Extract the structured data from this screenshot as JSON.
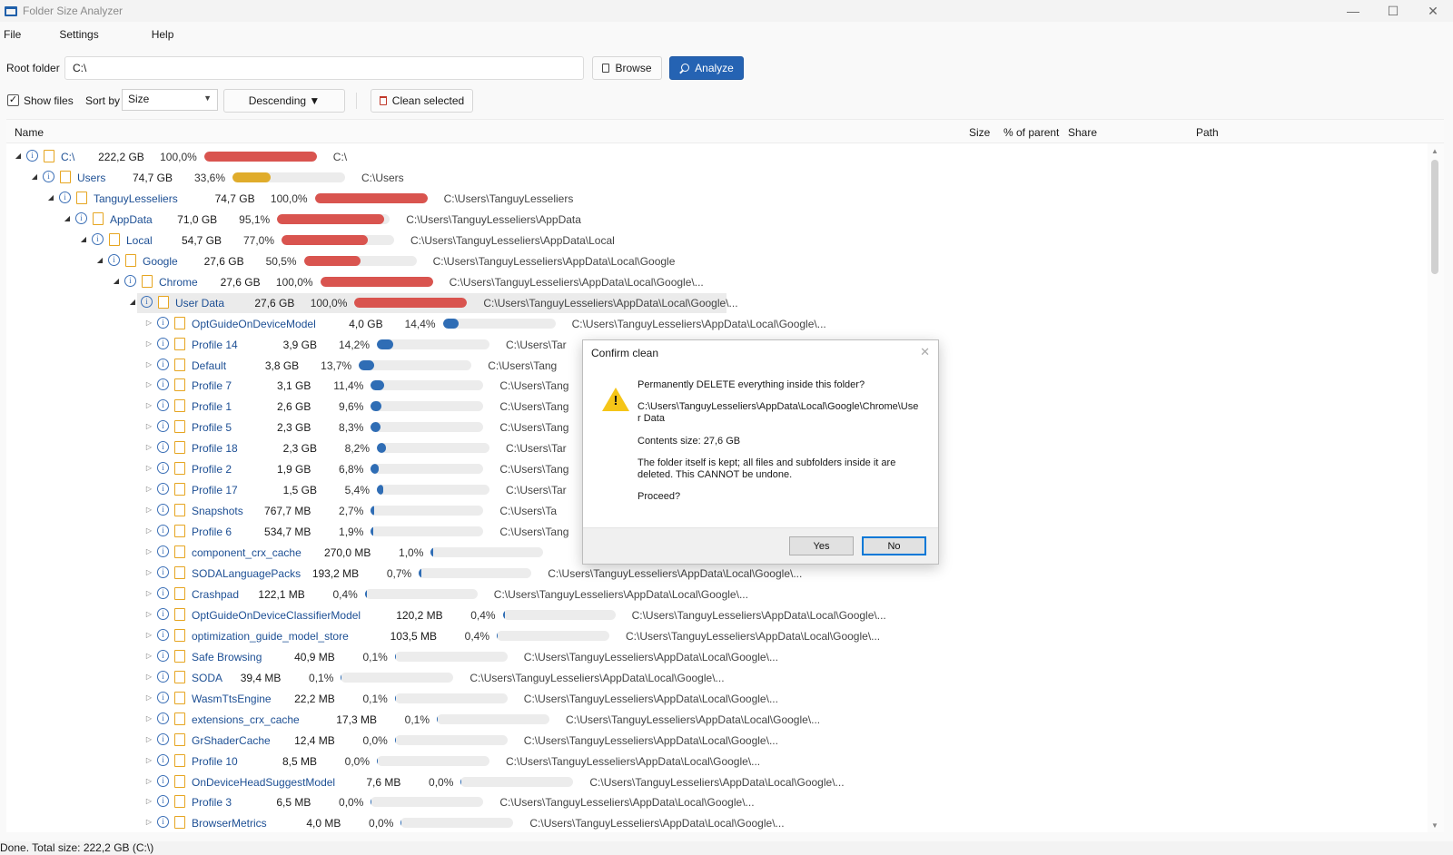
{
  "window": {
    "title": "Folder Size Analyzer",
    "controls": [
      "—",
      "☐",
      "✕"
    ]
  },
  "menu": [
    "File",
    "Settings",
    "Help"
  ],
  "root": {
    "label": "Root folder",
    "value": "C:\\",
    "browse_label": "Browse",
    "analyze_label": "Analyze"
  },
  "options": {
    "show_files_label": "Show files",
    "show_files_checked": true,
    "sort_by_label": "Sort by",
    "sort_value": "Size",
    "order_label": "Descending ▼",
    "clean_label": "Clean selected"
  },
  "columns": {
    "name": "Name",
    "size": "Size",
    "pct": "% of parent",
    "share": "Share",
    "path": "Path"
  },
  "colors": {
    "red": "#d9544f",
    "amber": "#e0ac2b",
    "blue": "#2f6db5",
    "accent": "#2563b3"
  },
  "tree": [
    {
      "depth": 0,
      "expanded": true,
      "name": "C:\\",
      "size": "222,2 GB",
      "pct": "100,0%",
      "share": 1.0,
      "color": "red",
      "path": "C:\\"
    },
    {
      "depth": 1,
      "expanded": true,
      "name": "Users",
      "size": "74,7 GB",
      "pct": "33,6%",
      "share": 0.336,
      "color": "amber",
      "path": "C:\\Users"
    },
    {
      "depth": 2,
      "expanded": true,
      "name": "TanguyLesseliers",
      "size": "74,7 GB",
      "pct": "100,0%",
      "share": 1.0,
      "color": "red",
      "path": "C:\\Users\\TanguyLesseliers"
    },
    {
      "depth": 3,
      "expanded": true,
      "name": "AppData",
      "size": "71,0 GB",
      "pct": "95,1%",
      "share": 0.951,
      "color": "red",
      "path": "C:\\Users\\TanguyLesseliers\\AppData"
    },
    {
      "depth": 4,
      "expanded": true,
      "name": "Local",
      "size": "54,7 GB",
      "pct": "77,0%",
      "share": 0.77,
      "color": "red",
      "path": "C:\\Users\\TanguyLesseliers\\AppData\\Local"
    },
    {
      "depth": 5,
      "expanded": true,
      "name": "Google",
      "size": "27,6 GB",
      "pct": "50,5%",
      "share": 0.505,
      "color": "red",
      "path": "C:\\Users\\TanguyLesseliers\\AppData\\Local\\Google"
    },
    {
      "depth": 6,
      "expanded": true,
      "name": "Chrome",
      "size": "27,6 GB",
      "pct": "100,0%",
      "share": 1.0,
      "color": "red",
      "path": "C:\\Users\\TanguyLesseliers\\AppData\\Local\\Google\\..."
    },
    {
      "depth": 7,
      "expanded": true,
      "selected": true,
      "name": "User Data",
      "size": "27,6 GB",
      "pct": "100,0%",
      "share": 1.0,
      "color": "red",
      "path": "C:\\Users\\TanguyLesseliers\\AppData\\Local\\Google\\..."
    },
    {
      "depth": 8,
      "name": "OptGuideOnDeviceModel",
      "size": "4,0 GB",
      "pct": "14,4%",
      "share": 0.144,
      "color": "blue",
      "path": "C:\\Users\\TanguyLesseliers\\AppData\\Local\\Google\\..."
    },
    {
      "depth": 8,
      "name": "Profile 14",
      "size": "3,9 GB",
      "pct": "14,2%",
      "share": 0.142,
      "color": "blue",
      "path": "C:\\Users\\Tar"
    },
    {
      "depth": 8,
      "name": "Default",
      "size": "3,8 GB",
      "pct": "13,7%",
      "share": 0.137,
      "color": "blue",
      "path": "C:\\Users\\Tang"
    },
    {
      "depth": 8,
      "name": "Profile 7",
      "size": "3,1 GB",
      "pct": "11,4%",
      "share": 0.114,
      "color": "blue",
      "path": "C:\\Users\\Tang"
    },
    {
      "depth": 8,
      "name": "Profile 1",
      "size": "2,6 GB",
      "pct": "9,6%",
      "share": 0.096,
      "color": "blue",
      "path": "C:\\Users\\Tang"
    },
    {
      "depth": 8,
      "name": "Profile 5",
      "size": "2,3 GB",
      "pct": "8,3%",
      "share": 0.083,
      "color": "blue",
      "path": "C:\\Users\\Tang"
    },
    {
      "depth": 8,
      "name": "Profile 18",
      "size": "2,3 GB",
      "pct": "8,2%",
      "share": 0.082,
      "color": "blue",
      "path": "C:\\Users\\Tar"
    },
    {
      "depth": 8,
      "name": "Profile 2",
      "size": "1,9 GB",
      "pct": "6,8%",
      "share": 0.068,
      "color": "blue",
      "path": "C:\\Users\\Tang"
    },
    {
      "depth": 8,
      "name": "Profile 17",
      "size": "1,5 GB",
      "pct": "5,4%",
      "share": 0.054,
      "color": "blue",
      "path": "C:\\Users\\Tar"
    },
    {
      "depth": 8,
      "name": "Snapshots",
      "size": "767,7 MB",
      "pct": "2,7%",
      "share": 0.027,
      "color": "blue",
      "path": "C:\\Users\\Ta"
    },
    {
      "depth": 8,
      "name": "Profile 6",
      "size": "534,7 MB",
      "pct": "1,9%",
      "share": 0.019,
      "color": "blue",
      "path": "C:\\Users\\Tang"
    },
    {
      "depth": 8,
      "name": "component_crx_cache",
      "size": "270,0 MB",
      "pct": "1,0%",
      "share": 0.01,
      "color": "blue",
      "path": ""
    },
    {
      "depth": 8,
      "name": "SODALanguagePacks",
      "size": "193,2 MB",
      "pct": "0,7%",
      "share": 0.007,
      "color": "blue",
      "path": "C:\\Users\\TanguyLesseliers\\AppData\\Local\\Google\\..."
    },
    {
      "depth": 8,
      "name": "Crashpad",
      "size": "122,1 MB",
      "pct": "0,4%",
      "share": 0.004,
      "color": "blue",
      "path": "C:\\Users\\TanguyLesseliers\\AppData\\Local\\Google\\..."
    },
    {
      "depth": 8,
      "name": "OptGuideOnDeviceClassifierModel",
      "size": "120,2 MB",
      "pct": "0,4%",
      "share": 0.004,
      "color": "blue",
      "path": "C:\\Users\\TanguyLesseliers\\AppData\\Local\\Google\\..."
    },
    {
      "depth": 8,
      "name": "optimization_guide_model_store",
      "size": "103,5 MB",
      "pct": "0,4%",
      "share": 0.0,
      "color": "blue",
      "path": "C:\\Users\\TanguyLesseliers\\AppData\\Local\\Google\\..."
    },
    {
      "depth": 8,
      "name": "Safe Browsing",
      "size": "40,9 MB",
      "pct": "0,1%",
      "share": 0.0,
      "color": "blue",
      "path": "C:\\Users\\TanguyLesseliers\\AppData\\Local\\Google\\..."
    },
    {
      "depth": 8,
      "name": "SODA",
      "size": "39,4 MB",
      "pct": "0,1%",
      "share": 0.0,
      "color": "blue",
      "path": "C:\\Users\\TanguyLesseliers\\AppData\\Local\\Google\\..."
    },
    {
      "depth": 8,
      "name": "WasmTtsEngine",
      "size": "22,2 MB",
      "pct": "0,1%",
      "share": 0.0,
      "color": "blue",
      "path": "C:\\Users\\TanguyLesseliers\\AppData\\Local\\Google\\..."
    },
    {
      "depth": 8,
      "name": "extensions_crx_cache",
      "size": "17,3 MB",
      "pct": "0,1%",
      "share": 0.0,
      "color": "blue",
      "path": "C:\\Users\\TanguyLesseliers\\AppData\\Local\\Google\\..."
    },
    {
      "depth": 8,
      "name": "GrShaderCache",
      "size": "12,4 MB",
      "pct": "0,0%",
      "share": 0.0,
      "color": "blue",
      "path": "C:\\Users\\TanguyLesseliers\\AppData\\Local\\Google\\..."
    },
    {
      "depth": 8,
      "name": "Profile 10",
      "size": "8,5 MB",
      "pct": "0,0%",
      "share": 0.0,
      "color": "blue",
      "path": "C:\\Users\\TanguyLesseliers\\AppData\\Local\\Google\\..."
    },
    {
      "depth": 8,
      "name": "OnDeviceHeadSuggestModel",
      "size": "7,6 MB",
      "pct": "0,0%",
      "share": 0.0,
      "color": "blue",
      "path": "C:\\Users\\TanguyLesseliers\\AppData\\Local\\Google\\..."
    },
    {
      "depth": 8,
      "name": "Profile 3",
      "size": "6,5 MB",
      "pct": "0,0%",
      "share": 0.0,
      "color": "blue",
      "path": "C:\\Users\\TanguyLesseliers\\AppData\\Local\\Google\\..."
    },
    {
      "depth": 8,
      "name": "BrowserMetrics",
      "size": "4,0 MB",
      "pct": "0,0%",
      "share": 0.0,
      "color": "blue",
      "path": "C:\\Users\\TanguyLesseliers\\AppData\\Local\\Google\\..."
    }
  ],
  "status": "Done.  Total size: 222,2 GB  (C:\\)",
  "dialog": {
    "title": "Confirm clean",
    "question": "Permanently DELETE everything inside this folder?",
    "path": "C:\\Users\\TanguyLesseliers\\AppData\\Local\\Google\\Chrome\\Use r Data",
    "contents": "Contents size: 27,6 GB",
    "note": "The folder itself is kept; all files and subfolders inside it are deleted. This CANNOT be undone.",
    "proceed": "Proceed?",
    "yes": "Yes",
    "no": "No"
  }
}
